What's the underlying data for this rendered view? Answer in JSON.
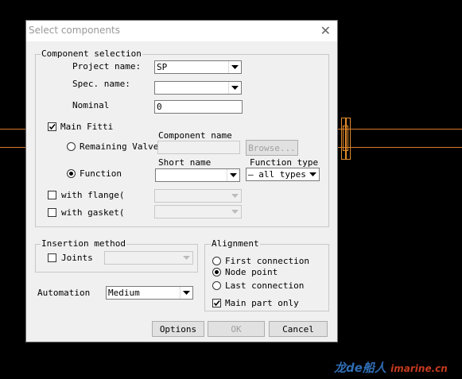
{
  "dialog": {
    "title": "Select components",
    "close_glyph": "✕"
  },
  "component_selection": {
    "legend": "Component selection",
    "project_name_label": "Project name:",
    "project_name_value": "SP",
    "spec_name_label": "Spec. name:",
    "spec_name_value": "",
    "nominal_label": "Nominal",
    "nominal_value": "0",
    "main_fitting_label": "Main Fitti",
    "main_fitting_checked": true,
    "remaining_valve_label": "Remaining Valve",
    "component_name_header": "Component name",
    "component_name_value": "",
    "browse_label": "Browse...",
    "function_label": "Function",
    "short_name_header": "Short name",
    "short_name_value": "",
    "function_type_header": "Function type",
    "function_type_value": "— all types",
    "with_flange_label": "with flange(",
    "with_gasket_label": "with gasket("
  },
  "insertion_method": {
    "legend": "Insertion method",
    "joints_label": "Joints"
  },
  "alignment": {
    "legend": "Alignment",
    "first_connection": "First connection",
    "node_point": "Node point",
    "last_connection": "Last connection",
    "main_part_only": "Main part only",
    "selected": "node_point"
  },
  "automation": {
    "label": "Automation",
    "value": "Medium"
  },
  "buttons": {
    "options": "Options",
    "ok": "OK",
    "cancel": "Cancel"
  },
  "watermark": {
    "cn": "龙de船人",
    "site": "imarine.cn"
  },
  "colors": {
    "pipe_line": "#d67a2a",
    "background": "#000000",
    "dialog_bg": "#f0f0f0"
  }
}
